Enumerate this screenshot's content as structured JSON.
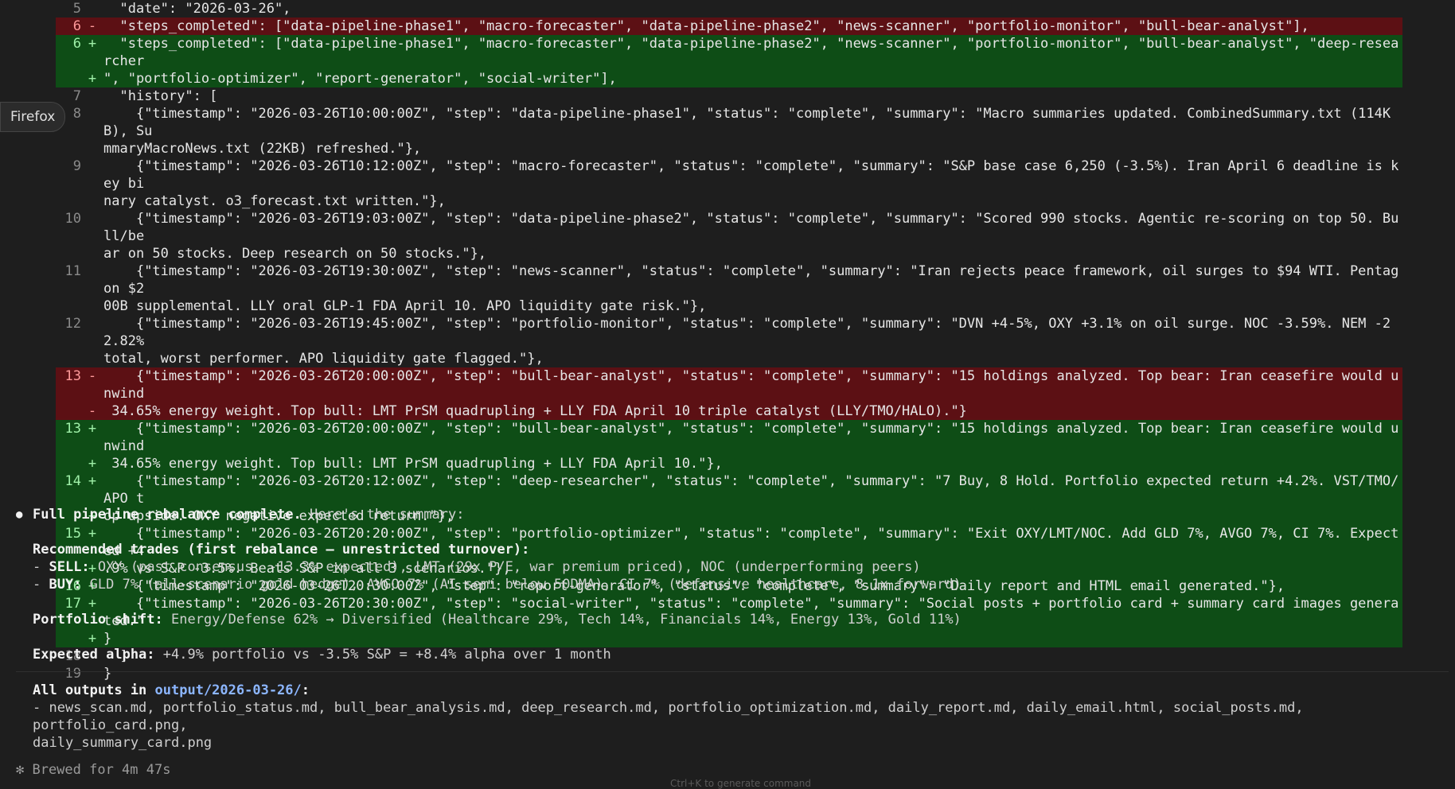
{
  "browser_tag": "Firefox",
  "diff_lines": [
    {
      "num": "5",
      "marker": "",
      "type": "ctx",
      "text": "  \"date\": \"2026-03-26\","
    },
    {
      "num": "6",
      "marker": "-",
      "type": "del",
      "text": "  \"steps_completed\": [\"data-pipeline-phase1\", \"macro-forecaster\", \"data-pipeline-phase2\", \"news-scanner\", \"portfolio-monitor\", \"bull-bear-analyst\"],"
    },
    {
      "num": "6",
      "marker": "+",
      "type": "add",
      "text": "  \"steps_completed\": [\"data-pipeline-phase1\", \"macro-forecaster\", \"data-pipeline-phase2\", \"news-scanner\", \"portfolio-monitor\", \"bull-bear-analyst\", \"deep-researcher"
    },
    {
      "num": "",
      "marker": "+",
      "type": "add",
      "text": "\", \"portfolio-optimizer\", \"report-generator\", \"social-writer\"],"
    },
    {
      "num": "7",
      "marker": "",
      "type": "ctx",
      "text": "  \"history\": ["
    },
    {
      "num": "8",
      "marker": "",
      "type": "ctx",
      "text": "    {\"timestamp\": \"2026-03-26T10:00:00Z\", \"step\": \"data-pipeline-phase1\", \"status\": \"complete\", \"summary\": \"Macro summaries updated. CombinedSummary.txt (114KB), Su"
    },
    {
      "num": "",
      "marker": "",
      "type": "ctx",
      "text": "mmaryMacroNews.txt (22KB) refreshed.\"},"
    },
    {
      "num": "9",
      "marker": "",
      "type": "ctx",
      "text": "    {\"timestamp\": \"2026-03-26T10:12:00Z\", \"step\": \"macro-forecaster\", \"status\": \"complete\", \"summary\": \"S&P base case 6,250 (-3.5%). Iran April 6 deadline is key bi"
    },
    {
      "num": "",
      "marker": "",
      "type": "ctx",
      "text": "nary catalyst. o3_forecast.txt written.\"},"
    },
    {
      "num": "10",
      "marker": "",
      "type": "ctx",
      "text": "    {\"timestamp\": \"2026-03-26T19:03:00Z\", \"step\": \"data-pipeline-phase2\", \"status\": \"complete\", \"summary\": \"Scored 990 stocks. Agentic re-scoring on top 50. Bull/be"
    },
    {
      "num": "",
      "marker": "",
      "type": "ctx",
      "text": "ar on 50 stocks. Deep research on 50 stocks.\"},"
    },
    {
      "num": "11",
      "marker": "",
      "type": "ctx",
      "text": "    {\"timestamp\": \"2026-03-26T19:30:00Z\", \"step\": \"news-scanner\", \"status\": \"complete\", \"summary\": \"Iran rejects peace framework, oil surges to $94 WTI. Pentagon $2"
    },
    {
      "num": "",
      "marker": "",
      "type": "ctx",
      "text": "00B supplemental. LLY oral GLP-1 FDA April 10. APO liquidity gate risk.\"},"
    },
    {
      "num": "12",
      "marker": "",
      "type": "ctx",
      "text": "    {\"timestamp\": \"2026-03-26T19:45:00Z\", \"step\": \"portfolio-monitor\", \"status\": \"complete\", \"summary\": \"DVN +4-5%, OXY +3.1% on oil surge. NOC -3.59%. NEM -22.82%"
    },
    {
      "num": "",
      "marker": "",
      "type": "ctx",
      "text": "total, worst performer. APO liquidity gate flagged.\"},"
    },
    {
      "num": "13",
      "marker": "-",
      "type": "del",
      "text": "    {\"timestamp\": \"2026-03-26T20:00:00Z\", \"step\": \"bull-bear-analyst\", \"status\": \"complete\", \"summary\": \"15 holdings analyzed. Top bear: Iran ceasefire would unwind"
    },
    {
      "num": "",
      "marker": "-",
      "type": "del",
      "text": " 34.65% energy weight. Top bull: LMT PrSM quadrupling + LLY FDA April 10 triple catalyst (LLY/TMO/HALO).\"}"
    },
    {
      "num": "13",
      "marker": "+",
      "type": "add",
      "text": "    {\"timestamp\": \"2026-03-26T20:00:00Z\", \"step\": \"bull-bear-analyst\", \"status\": \"complete\", \"summary\": \"15 holdings analyzed. Top bear: Iran ceasefire would unwind"
    },
    {
      "num": "",
      "marker": "+",
      "type": "add",
      "text": " 34.65% energy weight. Top bull: LMT PrSM quadrupling + LLY FDA April 10.\"},"
    },
    {
      "num": "14",
      "marker": "+",
      "type": "add",
      "text": "    {\"timestamp\": \"2026-03-26T20:12:00Z\", \"step\": \"deep-researcher\", \"status\": \"complete\", \"summary\": \"7 Buy, 8 Hold. Portfolio expected return +4.2%. VST/TMO/APO t"
    },
    {
      "num": "",
      "marker": "+",
      "type": "add",
      "text": "op upside. OXY negative expected return.\"},"
    },
    {
      "num": "15",
      "marker": "+",
      "type": "add",
      "text": "    {\"timestamp\": \"2026-03-26T20:20:00Z\", \"step\": \"portfolio-optimizer\", \"status\": \"complete\", \"summary\": \"Exit OXY/LMT/NOC. Add GLD 7%, AVGO 7%, CI 7%. Expected +4"
    },
    {
      "num": "",
      "marker": "+",
      "type": "add",
      "text": ".9% vs S&P -3.5%. Beats S&P in all 3 scenarios.\"},"
    },
    {
      "num": "16",
      "marker": "+",
      "type": "add",
      "text": "    {\"timestamp\": \"2026-03-26T20:30:00Z\", \"step\": \"report-generator\", \"status\": \"complete\", \"summary\": \"Daily report and HTML email generated.\"},"
    },
    {
      "num": "17",
      "marker": "+",
      "type": "add",
      "text": "    {\"timestamp\": \"2026-03-26T20:30:00Z\", \"step\": \"social-writer\", \"status\": \"complete\", \"summary\": \"Social posts + portfolio card + summary card images generated.\""
    },
    {
      "num": "",
      "marker": "+",
      "type": "add",
      "text": "}"
    },
    {
      "num": "18",
      "marker": "",
      "type": "ctx",
      "text": "  ]"
    },
    {
      "num": "19",
      "marker": "",
      "type": "ctx",
      "text": "}"
    }
  ],
  "summary": {
    "bullet": "●",
    "headline_bold": "Full pipeline rebalance complete.",
    "headline_rest": " Here's the summary:",
    "trades_heading": "Recommended trades (first rebalance — unrestricted turnover):",
    "sell_prefix": "- ",
    "sell_label": "SELL:",
    "sell_text": " OXY (past consensus, -13.3% expected), LMT (29x P/E, war premium priced), NOC (underperforming peers)",
    "buy_prefix": "- ",
    "buy_label": "BUY:",
    "buy_text": " GLD 7% (all-scenario gold hedge), AVGO 7% (AI semi below 50DMA), CI 7% (defensive healthcare, 8.1x forward)",
    "shift_label": "Portfolio shift:",
    "shift_text": " Energy/Defense 62% → Diversified (Healthcare 29%, Tech 14%, Financials 14%, Energy 13%, Gold 11%)",
    "alpha_label": "Expected alpha:",
    "alpha_text": " +4.9% portfolio vs -3.5% S&P = +8.4% alpha over 1 month",
    "outputs_label": "All outputs in ",
    "outputs_link": "output/2026-03-26/",
    "outputs_colon": ":",
    "outputs_list": "- news_scan.md, portfolio_status.md, bull_bear_analysis.md, deep_research.md, portfolio_optimization.md, daily_report.md, daily_email.html, social_posts.md, portfolio_card.png,\ndaily_summary_card.png",
    "brewed": "✻ Brewed for 4m 47s"
  },
  "footer_hint": "Ctrl+K to generate command"
}
